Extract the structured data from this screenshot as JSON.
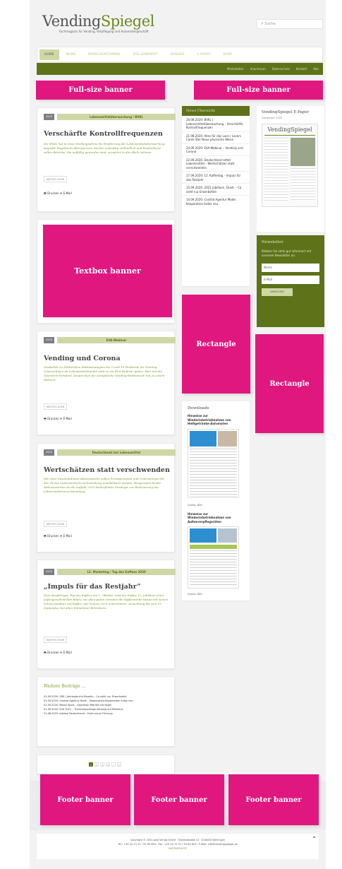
{
  "header": {
    "logo_part1": "Vending",
    "logo_part2": "Spiegel",
    "tagline": "Fachmagazin für Vending, Verpflegung und Automatengeschäft",
    "search_placeholder": "Suche"
  },
  "nav": {
    "items": [
      "HOME",
      "NEWS",
      "BRANCHENTERMINE",
      "STELLENMARKT",
      "DOSSIER",
      "E-PAPER",
      "SHOP"
    ]
  },
  "subnav": {
    "items": [
      "Mediadaten",
      "Impressum",
      "Datenschutz",
      "Kontakt",
      "Abo"
    ]
  },
  "banners": {
    "top_left": "Full-size banner",
    "top_right": "Full-size banner",
    "textbox": "Textbox banner",
    "rect1": "Rectangle",
    "rect2": "Rectangle",
    "footer1": "Footer banner",
    "footer2": "Footer banner",
    "footer3": "Footer banner"
  },
  "articles": [
    {
      "date": "2020",
      "category": "Lebensmittelüberwachung / BVKL",
      "title": "Verschärfte Kontrollfrequenzen",
      "excerpt": "Die BVKL hat in einer Stellungnahme die Einführung der Lebensmittelüberwachung begrüßt. Regelkontrollfrequenzen werden zukünftig verbindlich und Kontrolleure sollen Betriebe, die auffällig geworden sind, vermehrt in den Blick nehmen.",
      "more": "WEITER LESEN",
      "share": "Drucken",
      "mail": "E-Mail"
    },
    {
      "date": "2020",
      "category": "EVA-Webinar",
      "title": "Vending und Corona",
      "excerpt": "Zusätzlich zu Zahlreichen Risikostrategien der Covid-19 Pandemie für Vending-Unternehmen im Lebensmittelhandel wird es ein EVA-Webinar geben. Hier hat die Operators-Vorstand. Ansprechen bei europäische Vending-Wettbewerb VIA zu einem Webinar.",
      "more": "WEITER LESEN",
      "share": "Drucken",
      "mail": "E-Mail"
    },
    {
      "date": "2020",
      "category": "Deutschland isst Lebensmittel",
      "title": "Wertschätzen statt verschwenden",
      "excerpt": "Mit einer Zusatzprämien-Aktionswoche sollen Privatpersonen und Unternehmen für das Thema Lebensmittelverschwendung sensibilisiert werden. Bürgersprechende Aktionswochen ist die Auftakt 2019 landesfinaler Strategie zur Reduzierung der Lebensmittelverschwendung.",
      "more": "WEITER LESEN",
      "share": "Drucken",
      "mail": "E-Mail"
    },
    {
      "date": "2020",
      "category": "12. Marketing / Tag des Kaffees 2020",
      "title": "„Impuls für das Restjahr“",
      "excerpt": "Zum diesjährigen Tag des Kaffees am 1. Oktober wird der Kaffee 12. Jubiläum einer außergewöhnlichen Bilanz mit allen guten Gründen die Kaffeemarkt-Saison mit seinen Schwerpunkten auf Kaffee und Genuss 2020 unterstützen. Anmeldung bis zum 15. September bei allen Teilnehmer-Betreibern.",
      "more": "WEITER LESEN",
      "share": "Drucken",
      "mail": "E-Mail"
    }
  ],
  "more_posts": {
    "title": "Weitere Beiträge …",
    "items": [
      "01.09.2020: VDE | Jahresbericht Moselle – Ca sieht nur Erwerbsfeld",
      "01.09.2020: Coshild Agentur Mode – Kooperation-Kooperation Index neu",
      "01.09.2020: Modul Sport – Goodman Betrieb mit Vogel",
      "01.09.2020: EVA 2021 – Thermalsportlage Konzept auf Resilienz",
      "31.08.2020: Jelbesa Deutschland – Erste neuer Führung"
    ]
  },
  "pagination": [
    "1",
    "2",
    "3",
    "4",
    "›",
    "»"
  ],
  "news": {
    "title": "News-Übersicht",
    "items": [
      "28.08.2020: BVKL | Lebensmittelüberwachung – Verschärfte Kontrollfrequenzen",
      "21.08.2020: Alles für das Lace | Lavers Cards iDer Neue physische Weise",
      "24.09.2020: EVA-Webinar – Vending und Corona",
      "22.09.2020: Deutschland rettet Lebensmittel – Wertschätzen statt verschwenden",
      "17.09.2020: 12. Kaffeetag – Impuls für das Restjahr",
      "15.09.2020: 2021 Jubiläum, Duell: – Ca sieht nur Erwerbsfeld",
      "14.09.2020: Coshild Agentur Mode: Kooperation Index neu"
    ]
  },
  "epaper": {
    "title": "VendingSpiegel E-Paper",
    "issue": "September 2020",
    "cover_logo": "VendingSpiegel"
  },
  "newsletter": {
    "title": "Newsletter",
    "text": "Bleiben Sie stets gut informiert mit unserem Newsletter an:",
    "name_placeholder": "Name",
    "email_placeholder": "E-Mail",
    "button": "ANMELDEN"
  },
  "downloads": {
    "title": "Downloads",
    "doc1_title": "Hinweise zur Wiederinbetriebnahme von Heißgetränke-Automaten",
    "doc1_source": "Quelle: BDV",
    "doc2_title": "Hinweise zur Wiederinbetriebnahme von Außenverpflegeräten",
    "doc2_source": "Quelle: BDV"
  },
  "footer": {
    "line1": "Copyright © 2020 pwd Verlag GmbH · Obertalstraße 12 · D-60000 Kehlingen",
    "line2": "Tel.: +49 (0) 21 51 / 55 69 604 · Fax: +49 (0) 21 51 / 55 69 609 · E-Mail: info@vendingspiegel.de",
    "link": "DATENSCHUTZ"
  },
  "colors": {
    "accent": "#5d7219",
    "banner": "#e0177f",
    "category": "#cfd7a6",
    "excerpt": "#7a962b"
  }
}
